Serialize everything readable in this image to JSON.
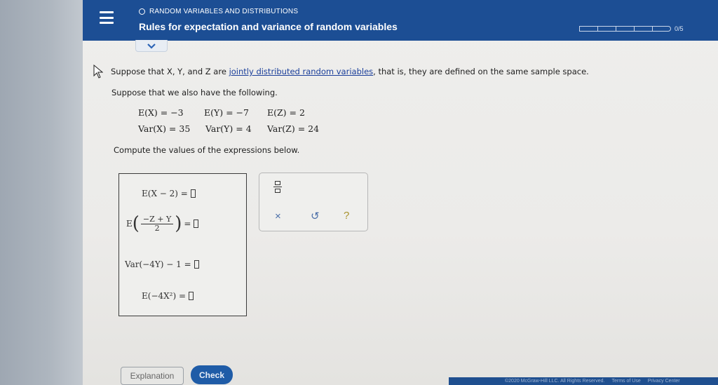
{
  "header": {
    "topic": "RANDOM VARIABLES AND DISTRIBUTIONS",
    "title": "Rules for expectation and variance of random variables",
    "progress_text": "0/5",
    "progress_segments": 5
  },
  "question": {
    "intro_before_link": "Suppose that X, Y, and Z are ",
    "link_text": "jointly distributed random variables",
    "intro_after_link": ", that is, they are defined on the same sample space.",
    "also_text": "Suppose that we also have the following.",
    "given": {
      "ex": "E(X) = −3",
      "ey": "E(Y) = −7",
      "ez": "E(Z) = 2",
      "varx": "Var(X) = 35",
      "vary": "Var(Y) = 4",
      "varz": "Var(Z) = 24"
    },
    "compute_text": "Compute the values of the expressions below."
  },
  "answers": {
    "expr1": "E(X − 2) =",
    "expr2_prefix": "E",
    "expr2_num": "−Z + Y",
    "expr2_den": "2",
    "expr2_eq": "=",
    "expr3": "Var(−4Y) − 1 =",
    "expr4": "E(−4X²) ="
  },
  "toolbox": {
    "clear_label": "×",
    "undo_label": "↺",
    "help_label": "?"
  },
  "buttons": {
    "explanation": "Explanation",
    "check": "Check"
  },
  "footer": {
    "copyright": "©2020 McGraw-Hill LLC. All Rights Reserved.",
    "terms": "Terms of Use",
    "privacy": "Privacy Center"
  },
  "colors": {
    "header_bg": "#1c4e94",
    "check_bg": "#1f5ca7"
  }
}
